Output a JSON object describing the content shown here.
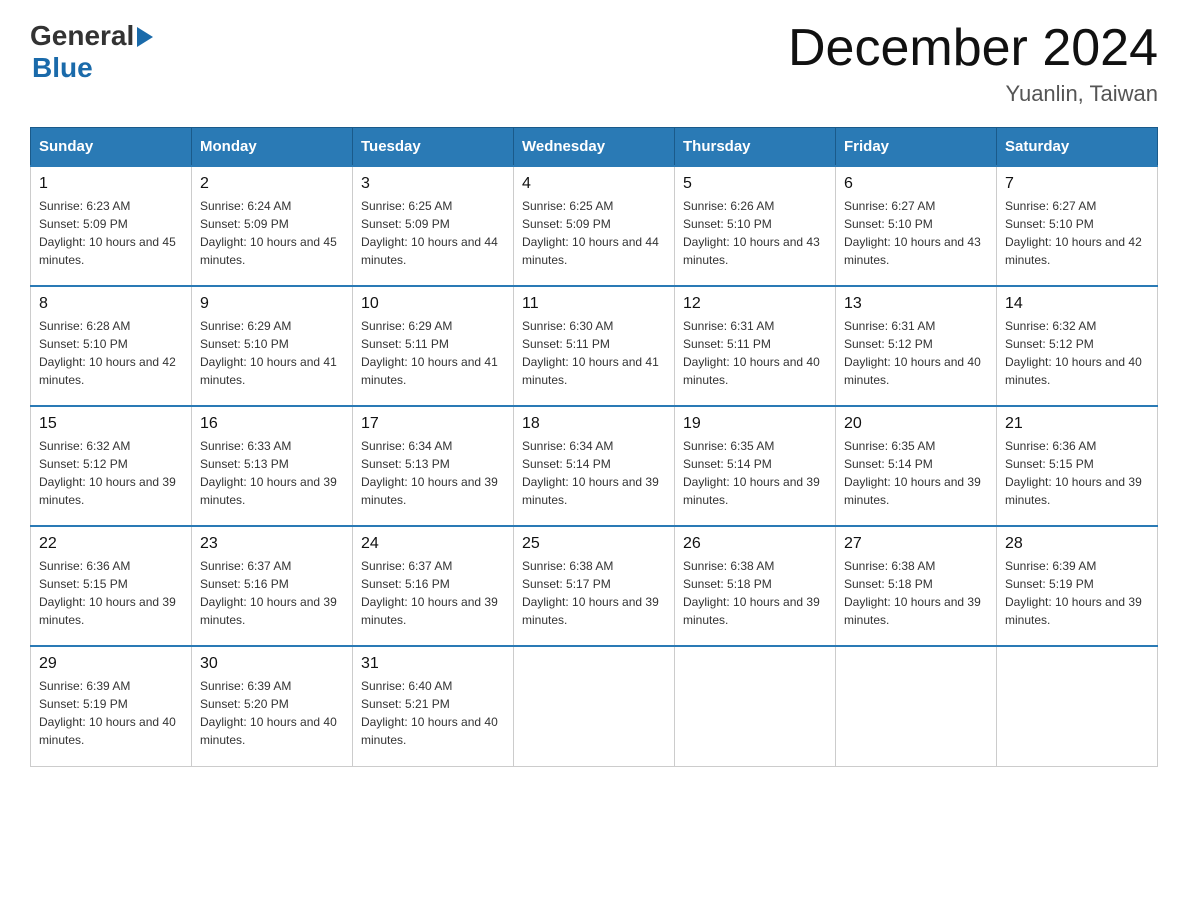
{
  "header": {
    "logo_general": "General",
    "logo_blue": "Blue",
    "month_title": "December 2024",
    "location": "Yuanlin, Taiwan"
  },
  "weekdays": [
    "Sunday",
    "Monday",
    "Tuesday",
    "Wednesday",
    "Thursday",
    "Friday",
    "Saturday"
  ],
  "weeks": [
    [
      {
        "day": "1",
        "sunrise": "6:23 AM",
        "sunset": "5:09 PM",
        "daylight": "10 hours and 45 minutes."
      },
      {
        "day": "2",
        "sunrise": "6:24 AM",
        "sunset": "5:09 PM",
        "daylight": "10 hours and 45 minutes."
      },
      {
        "day": "3",
        "sunrise": "6:25 AM",
        "sunset": "5:09 PM",
        "daylight": "10 hours and 44 minutes."
      },
      {
        "day": "4",
        "sunrise": "6:25 AM",
        "sunset": "5:09 PM",
        "daylight": "10 hours and 44 minutes."
      },
      {
        "day": "5",
        "sunrise": "6:26 AM",
        "sunset": "5:10 PM",
        "daylight": "10 hours and 43 minutes."
      },
      {
        "day": "6",
        "sunrise": "6:27 AM",
        "sunset": "5:10 PM",
        "daylight": "10 hours and 43 minutes."
      },
      {
        "day": "7",
        "sunrise": "6:27 AM",
        "sunset": "5:10 PM",
        "daylight": "10 hours and 42 minutes."
      }
    ],
    [
      {
        "day": "8",
        "sunrise": "6:28 AM",
        "sunset": "5:10 PM",
        "daylight": "10 hours and 42 minutes."
      },
      {
        "day": "9",
        "sunrise": "6:29 AM",
        "sunset": "5:10 PM",
        "daylight": "10 hours and 41 minutes."
      },
      {
        "day": "10",
        "sunrise": "6:29 AM",
        "sunset": "5:11 PM",
        "daylight": "10 hours and 41 minutes."
      },
      {
        "day": "11",
        "sunrise": "6:30 AM",
        "sunset": "5:11 PM",
        "daylight": "10 hours and 41 minutes."
      },
      {
        "day": "12",
        "sunrise": "6:31 AM",
        "sunset": "5:11 PM",
        "daylight": "10 hours and 40 minutes."
      },
      {
        "day": "13",
        "sunrise": "6:31 AM",
        "sunset": "5:12 PM",
        "daylight": "10 hours and 40 minutes."
      },
      {
        "day": "14",
        "sunrise": "6:32 AM",
        "sunset": "5:12 PM",
        "daylight": "10 hours and 40 minutes."
      }
    ],
    [
      {
        "day": "15",
        "sunrise": "6:32 AM",
        "sunset": "5:12 PM",
        "daylight": "10 hours and 39 minutes."
      },
      {
        "day": "16",
        "sunrise": "6:33 AM",
        "sunset": "5:13 PM",
        "daylight": "10 hours and 39 minutes."
      },
      {
        "day": "17",
        "sunrise": "6:34 AM",
        "sunset": "5:13 PM",
        "daylight": "10 hours and 39 minutes."
      },
      {
        "day": "18",
        "sunrise": "6:34 AM",
        "sunset": "5:14 PM",
        "daylight": "10 hours and 39 minutes."
      },
      {
        "day": "19",
        "sunrise": "6:35 AM",
        "sunset": "5:14 PM",
        "daylight": "10 hours and 39 minutes."
      },
      {
        "day": "20",
        "sunrise": "6:35 AM",
        "sunset": "5:14 PM",
        "daylight": "10 hours and 39 minutes."
      },
      {
        "day": "21",
        "sunrise": "6:36 AM",
        "sunset": "5:15 PM",
        "daylight": "10 hours and 39 minutes."
      }
    ],
    [
      {
        "day": "22",
        "sunrise": "6:36 AM",
        "sunset": "5:15 PM",
        "daylight": "10 hours and 39 minutes."
      },
      {
        "day": "23",
        "sunrise": "6:37 AM",
        "sunset": "5:16 PM",
        "daylight": "10 hours and 39 minutes."
      },
      {
        "day": "24",
        "sunrise": "6:37 AM",
        "sunset": "5:16 PM",
        "daylight": "10 hours and 39 minutes."
      },
      {
        "day": "25",
        "sunrise": "6:38 AM",
        "sunset": "5:17 PM",
        "daylight": "10 hours and 39 minutes."
      },
      {
        "day": "26",
        "sunrise": "6:38 AM",
        "sunset": "5:18 PM",
        "daylight": "10 hours and 39 minutes."
      },
      {
        "day": "27",
        "sunrise": "6:38 AM",
        "sunset": "5:18 PM",
        "daylight": "10 hours and 39 minutes."
      },
      {
        "day": "28",
        "sunrise": "6:39 AM",
        "sunset": "5:19 PM",
        "daylight": "10 hours and 39 minutes."
      }
    ],
    [
      {
        "day": "29",
        "sunrise": "6:39 AM",
        "sunset": "5:19 PM",
        "daylight": "10 hours and 40 minutes."
      },
      {
        "day": "30",
        "sunrise": "6:39 AM",
        "sunset": "5:20 PM",
        "daylight": "10 hours and 40 minutes."
      },
      {
        "day": "31",
        "sunrise": "6:40 AM",
        "sunset": "5:21 PM",
        "daylight": "10 hours and 40 minutes."
      },
      null,
      null,
      null,
      null
    ]
  ]
}
